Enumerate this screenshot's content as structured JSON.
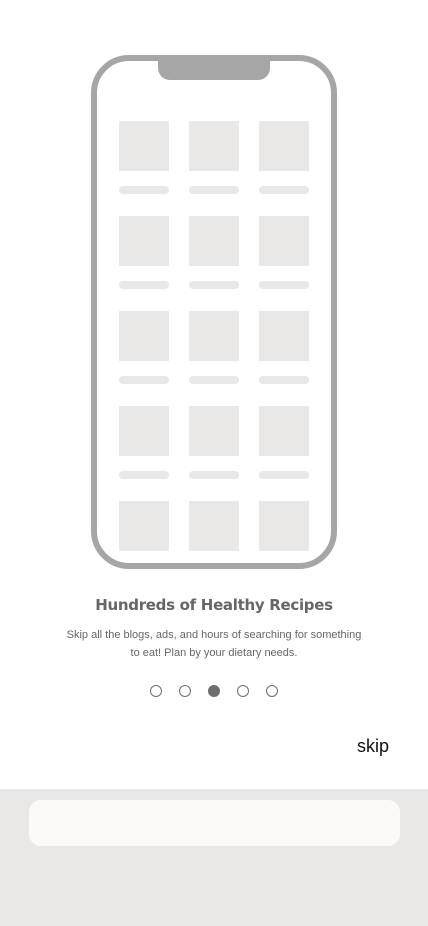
{
  "onboarding": {
    "title": "Hundreds of Healthy Recipes",
    "subtitle": "Skip all the blogs, ads, and hours of searching for something to eat! Plan by your dietary needs.",
    "page_count": 5,
    "active_page": 3,
    "skip_label": "skip"
  },
  "colors": {
    "phone_frame": "#a6a6a6",
    "placeholder": "#e9e8e7",
    "text": "#666666",
    "footer_bg": "#e9e8e6"
  }
}
